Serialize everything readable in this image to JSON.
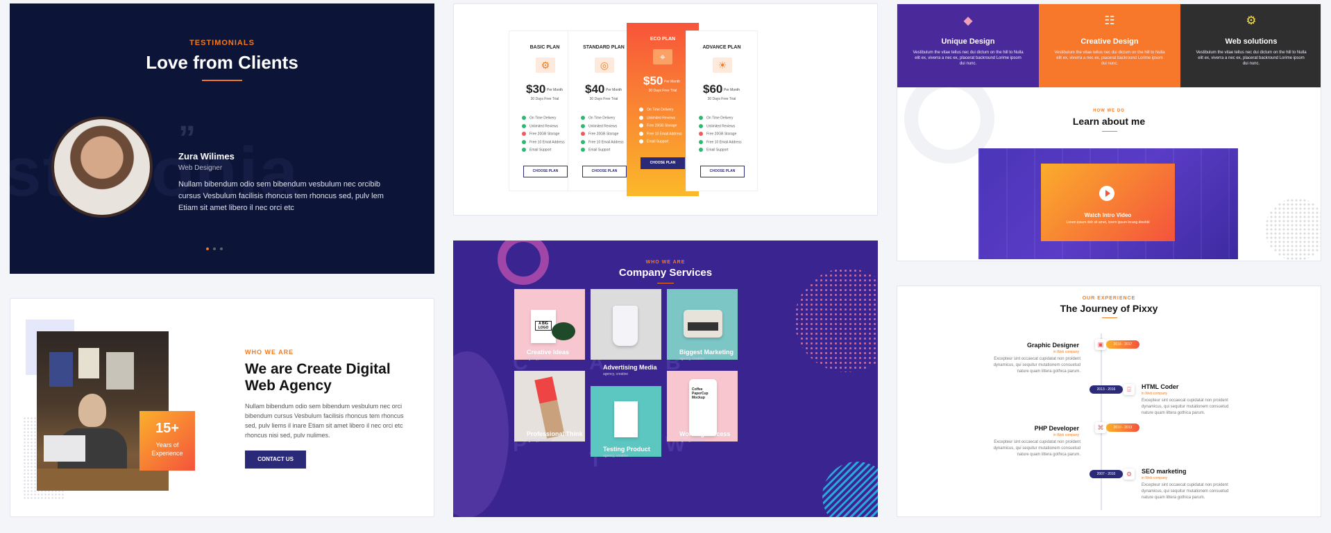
{
  "testimonials": {
    "subtitle": "TESTIMONIALS",
    "title": "Love from Clients",
    "bg_word": "stimonia",
    "quote_mark": "”",
    "name": "Zura Wilimes",
    "role": "Web Designer",
    "text": "Nullam bibendum odio sem bibendum vesbulum nec orcibib cursus Vesbulum facilisis rhoncus tem rhoncus sed, pulv lem Etiam sit amet libero il nec orci etc"
  },
  "pricing": {
    "plans": [
      {
        "name": "BASIC PLAN",
        "icon": "gear-icon",
        "price": "$30",
        "per": "Per Month",
        "trial": "30 Days Free Trial",
        "button": "CHOOSE PLAN"
      },
      {
        "name": "STANDARD PLAN",
        "icon": "lifebuoy-icon",
        "price": "$40",
        "per": "Per Month",
        "trial": "30 Days Free Trial",
        "button": "CHOOSE PLAN"
      },
      {
        "name": "ECO PLAN",
        "icon": "target-icon",
        "price": "$50",
        "per": "Per Month",
        "trial": "30 Days Free Trial",
        "button": "CHOOSE PLAN"
      },
      {
        "name": "ADVANCE PLAN",
        "icon": "sun-icon",
        "price": "$60",
        "per": "Per Month",
        "trial": "30 Days Free Trial",
        "button": "CHOOSE PLAN"
      }
    ],
    "features": [
      "On Time Delivery",
      "Unlimited Reviews",
      "Free 20GB Storage",
      "Free 10 Email Address",
      "Email Support"
    ]
  },
  "services": {
    "subtitle": "WHO WE ARE",
    "title": "Company Services",
    "items": [
      {
        "title": "Creative Ideas",
        "tags": "agency, creative",
        "letter": "C",
        "bg": "#f7c6cf"
      },
      {
        "title": "Advertising Media",
        "tags": "agency, creative",
        "letter": "A",
        "bg": "#dcdcdc"
      },
      {
        "title": "Biggest Marketing",
        "tags": "agency, creative",
        "letter": "B",
        "bg": "#7cc6c6"
      },
      {
        "title": "Professional Think",
        "tags": "agency, creative",
        "letter": "P",
        "bg": "#e6e1dc"
      },
      {
        "title": "Testing Product",
        "tags": "agency, creative",
        "letter": "T",
        "bg": "#5cc6c0"
      },
      {
        "title": "Working Process",
        "tags": "agency, creative",
        "letter": "W",
        "bg": "#f7c6cf"
      }
    ],
    "logo_text": "A BIG LOGO",
    "cup_text": "Coffee PaperCup Mockup"
  },
  "features": {
    "cols": [
      {
        "title": "Unique Design",
        "icon": "diamond-icon",
        "desc": "Vestibulum the vitae tellus nec dui dictum on the hill to Nulla elit ex, viverra a nec ex, placerat backround Lorime ipsom dui nunc.",
        "bg": "#4a2a9a"
      },
      {
        "title": "Creative Design",
        "icon": "sitemap-icon",
        "desc": "Vestibulum the vitae tellus nec dui dictum on the hill to Nulla elit ex, viverra a nec ex, placerat backround Lorime ipsom dui nunc.",
        "bg": "#f7782a"
      },
      {
        "title": "Web solutions",
        "icon": "cog-icon",
        "desc": "Vestibulum the vitae tellus nec dui dictum on the hill to Nulla elit ex, viverra a nec ex, placerat backround Lorime ipsom dui nunc.",
        "bg": "#2f2f2f"
      }
    ],
    "subtitle": "HOW WE DO",
    "title": "Learn about me",
    "video_title": "Watch Intro Video",
    "video_sub": "Lorem ipsum dolr sit amet, lorem ipsum lorang dioshbl"
  },
  "agency": {
    "subtitle": "WHO WE ARE",
    "title": "We are Create Digital Web Agency",
    "body": "Nullam bibendum odio sem bibendum vesbulum nec orci bibendum cursus Vesbulum facilisis rhoncus tem rhoncus sed, pulv liems il inare  Etiam sit amet libero il nec orci etc rhoncus nisi sed, pulv nulimes.",
    "badge_number": "15+",
    "badge_label": "Years of Experience",
    "button": "CONTACT US"
  },
  "journey": {
    "subtitle": "OUR EXPERIENCE",
    "title": "The Journey of Pixxy",
    "items": [
      {
        "title": "Graphic Designer",
        "company": "in Web company",
        "years": "2016 - 2017",
        "side": "left",
        "desc": "Excepteur sint occaecat cupidatat non proident dynamicus, qui sequitur mutationem consuetud nature quam littera gothica parum."
      },
      {
        "title": "HTML Coder",
        "company": "in Web company",
        "years": "2013 - 2016",
        "side": "right",
        "desc": "Excepteur sint occaecat cupidatat non proident dynamicus, qui sequitur mutationem consuetud nature quam littera gothica parum."
      },
      {
        "title": "PHP Developer",
        "company": "in Web company",
        "years": "2010 - 2013",
        "side": "left",
        "desc": "Excepteur sint occaecat cupidatat non proident dynamicus, qui sequitur mutationem consuetud nature quam littera gothica parum."
      },
      {
        "title": "SEO marketing",
        "company": "in Web company",
        "years": "2007 - 2010",
        "side": "right",
        "desc": "Excepteur sint occaecat cupidatat non proident dynamicus, qui sequitur mutationem consuetud nature quam littera gothica parum."
      }
    ]
  },
  "colors": {
    "accent": "#f47b20",
    "navy": "#0c1438",
    "purple": "#3a2590",
    "button": "#2a2a78"
  }
}
